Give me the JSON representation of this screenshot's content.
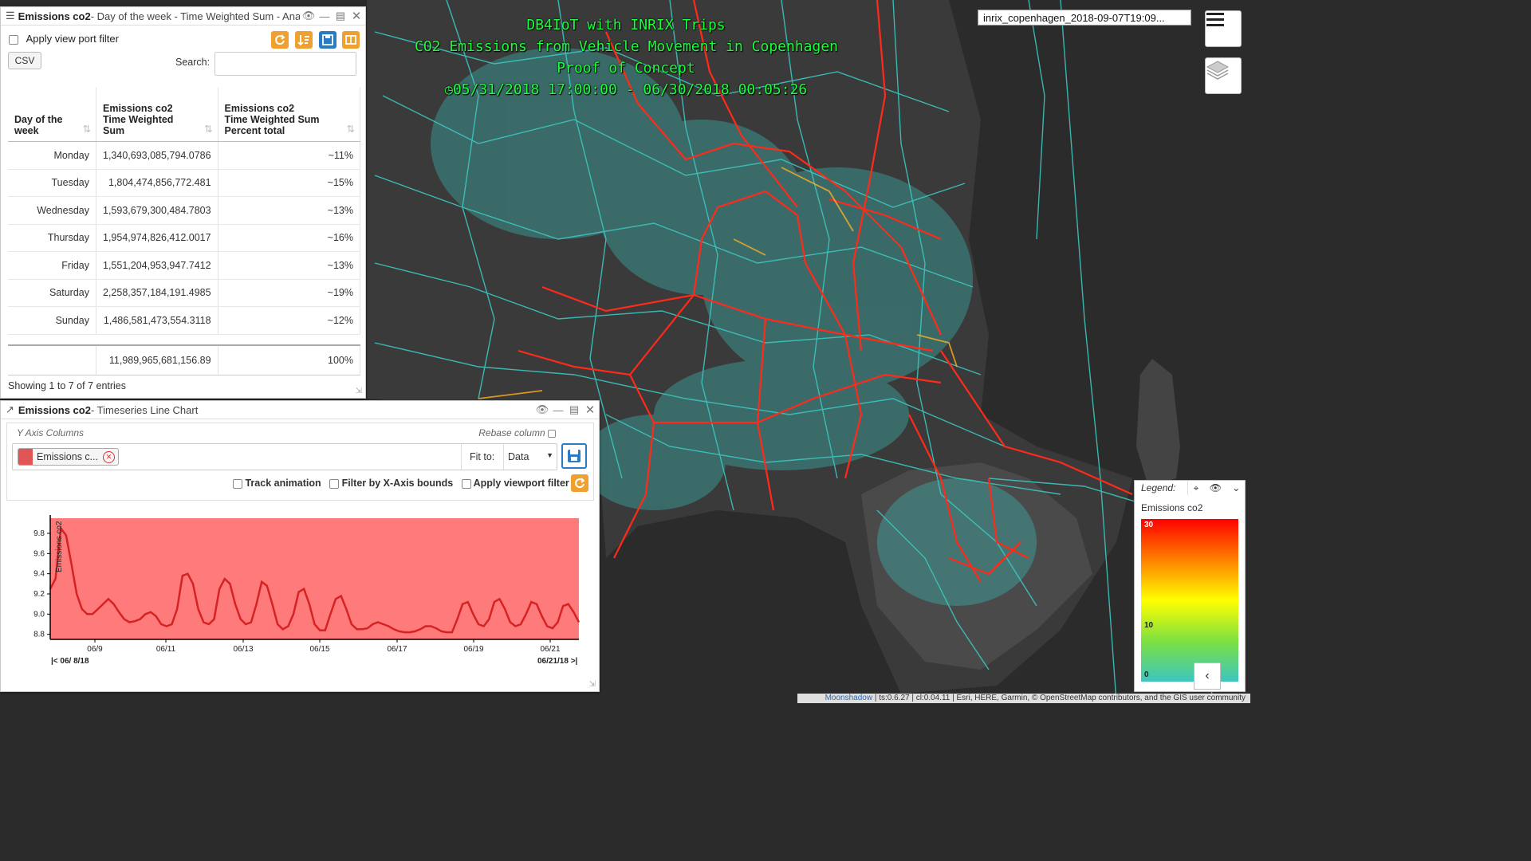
{
  "map": {
    "title_lines": [
      "DB4IoT with INRIX Trips",
      "CO2 Emissions from Vehicle Movement in Copenhagen",
      "Proof of Concept"
    ],
    "time_range": "05/31/2018 17:00:00 - 06/30/2018 00:05:26",
    "clock_icon": "clock-icon",
    "layer_name": "inrix_copenhagen_2018-09-07T19:09...",
    "menu_icon": "hamburger-icon",
    "layers_icon": "layers-icon",
    "colors": {
      "background": "#2b2b2b",
      "land": "#3a3a3a",
      "trips": "#3cc6c0",
      "roads": "#ff2a1a",
      "title": "#19ff3a"
    }
  },
  "table_panel": {
    "title_bold": "Emissions co2",
    "title_rest": " - Day of the week - Time Weighted Sum - Anal",
    "apply_filter_label": "Apply view port filter",
    "csv_label": "CSV",
    "search_label": "Search:",
    "search_value": "",
    "columns": [
      [
        "Day of the",
        "week"
      ],
      [
        "Emissions co2",
        "Time Weighted",
        "Sum"
      ],
      [
        "Emissions co2",
        "Time Weighted Sum",
        "Percent total"
      ]
    ],
    "rows": [
      [
        "Monday",
        "1,340,693,085,794.0786",
        "~11%"
      ],
      [
        "Tuesday",
        "1,804,474,856,772.481",
        "~15%"
      ],
      [
        "Wednesday",
        "1,593,679,300,484.7803",
        "~13%"
      ],
      [
        "Thursday",
        "1,954,974,826,412.0017",
        "~16%"
      ],
      [
        "Friday",
        "1,551,204,953,947.7412",
        "~13%"
      ],
      [
        "Saturday",
        "2,258,357,184,191.4985",
        "~19%"
      ],
      [
        "Sunday",
        "1,486,581,473,554.3118",
        "~12%"
      ]
    ],
    "footer": [
      "",
      "11,989,965,681,156.89",
      "100%"
    ],
    "showing": "Showing 1 to 7 of 7 entries",
    "icon_colors": {
      "refresh": "#f0a030",
      "sort": "#f0a030",
      "save": "#2a7bc4",
      "columns": "#f0a030"
    }
  },
  "chart_panel": {
    "title_bold": "Emissions co2",
    "title_rest": " - Timeseries Line Chart",
    "y_axis_columns_label": "Y Axis Columns",
    "rebase_label": "Rebase column",
    "chip_label": "Emissions c...",
    "chip_color": "#e05555",
    "fit_label": "Fit to:",
    "fit_value": "Data",
    "track_label": "Track animation",
    "filter_x_label": "Filter by X-Axis bounds",
    "apply_viewport_label": "Apply viewport filter",
    "range_start": "|< 06/ 8/18",
    "range_end": "06/21/18 >|"
  },
  "chart_data": {
    "type": "line",
    "title": "",
    "xlabel": "",
    "ylabel": "Emissions co2",
    "ylim": [
      8.75,
      9.95
    ],
    "x_tick_labels": [
      "06/9",
      "06/11",
      "06/13",
      "06/15",
      "06/17",
      "06/19",
      "06/21"
    ],
    "y_tick_labels": [
      "8.8",
      "9.0",
      "9.2",
      "9.4",
      "9.6",
      "9.8"
    ],
    "x_range": [
      "2018-06-08",
      "2018-06-21"
    ],
    "grid": false,
    "area_color": "#ff7b7b",
    "line_color": "#d62222",
    "series": [
      {
        "name": "Emissions co2",
        "values": [
          9.25,
          9.35,
          9.85,
          9.78,
          9.5,
          9.2,
          9.05,
          9.0,
          9.0,
          9.05,
          9.1,
          9.15,
          9.1,
          9.02,
          8.95,
          8.92,
          8.93,
          8.95,
          9.0,
          9.02,
          8.98,
          8.9,
          8.88,
          8.9,
          9.05,
          9.38,
          9.4,
          9.3,
          9.05,
          8.92,
          8.9,
          8.95,
          9.25,
          9.35,
          9.3,
          9.1,
          8.95,
          8.9,
          8.92,
          9.1,
          9.32,
          9.28,
          9.1,
          8.9,
          8.85,
          8.88,
          9.0,
          9.22,
          9.25,
          9.1,
          8.9,
          8.84,
          8.84,
          9.0,
          9.15,
          9.18,
          9.05,
          8.9,
          8.85,
          8.85,
          8.86,
          8.9,
          8.92,
          8.9,
          8.88,
          8.85,
          8.83,
          8.82,
          8.82,
          8.83,
          8.85,
          8.88,
          8.88,
          8.86,
          8.83,
          8.82,
          8.82,
          8.95,
          9.1,
          9.12,
          9.0,
          8.9,
          8.88,
          8.95,
          9.12,
          9.15,
          9.05,
          8.92,
          8.88,
          8.9,
          9.0,
          9.12,
          9.1,
          8.98,
          8.88,
          8.86,
          8.92,
          9.08,
          9.1,
          9.02,
          8.92
        ]
      }
    ]
  },
  "legend": {
    "title": "Legend:",
    "field": "Emissions co2",
    "labels": [
      "30",
      "10",
      "0"
    ],
    "gradient": [
      "#ff0000",
      "#ff8000",
      "#ffff00",
      "#7ee040",
      "#3cc6c0"
    ],
    "collapse_icon": "chevron-left-icon"
  },
  "attribution": {
    "brand": "Moonshadow",
    "text": " | ts:0.6.27 | cl:0.04.11 | Esri, HERE, Garmin, © OpenStreetMap contributors, and the GIS user community"
  }
}
